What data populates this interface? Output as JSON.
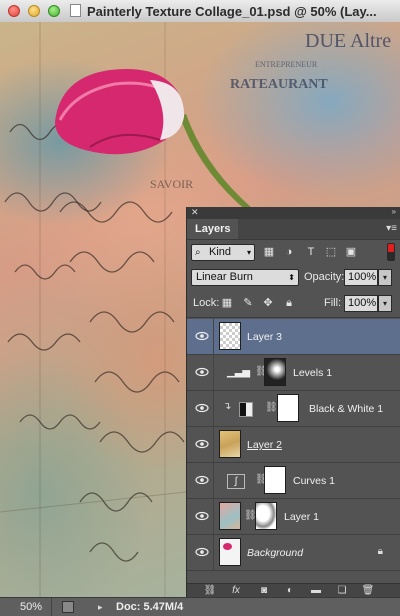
{
  "window": {
    "title": "Painterly Texture Collage_01.psd @ 50% (Lay..."
  },
  "canvas": {
    "texts": [
      "DUE Altre",
      "ENTREPRENEUR",
      "RATEAURANT",
      "SAVOIR"
    ]
  },
  "layers_panel": {
    "tab": "Layers",
    "filter_kind": "Kind",
    "blend_mode": "Linear Burn",
    "opacity_label": "Opacity:",
    "opacity_value": "100%",
    "lock_label": "Lock:",
    "fill_label": "Fill:",
    "fill_value": "100%",
    "layers": [
      {
        "name": "Layer 3",
        "selected": true
      },
      {
        "name": "Levels 1"
      },
      {
        "name": "Black & White 1"
      },
      {
        "name": "Layer 2"
      },
      {
        "name": "Curves 1"
      },
      {
        "name": "Layer 1"
      },
      {
        "name": "Background"
      }
    ],
    "bottom_icons": [
      "link-icon",
      "fx-icon",
      "mask-icon",
      "adjustment-icon",
      "folder-icon",
      "new-layer-icon",
      "trash-icon"
    ]
  },
  "status_bar": {
    "zoom": "50%",
    "doc": "Doc: 5.47M/4"
  },
  "colors": {
    "panel_bg": "#535353",
    "selected_layer": "#5d6f8c",
    "tulip": "#d6286e"
  }
}
